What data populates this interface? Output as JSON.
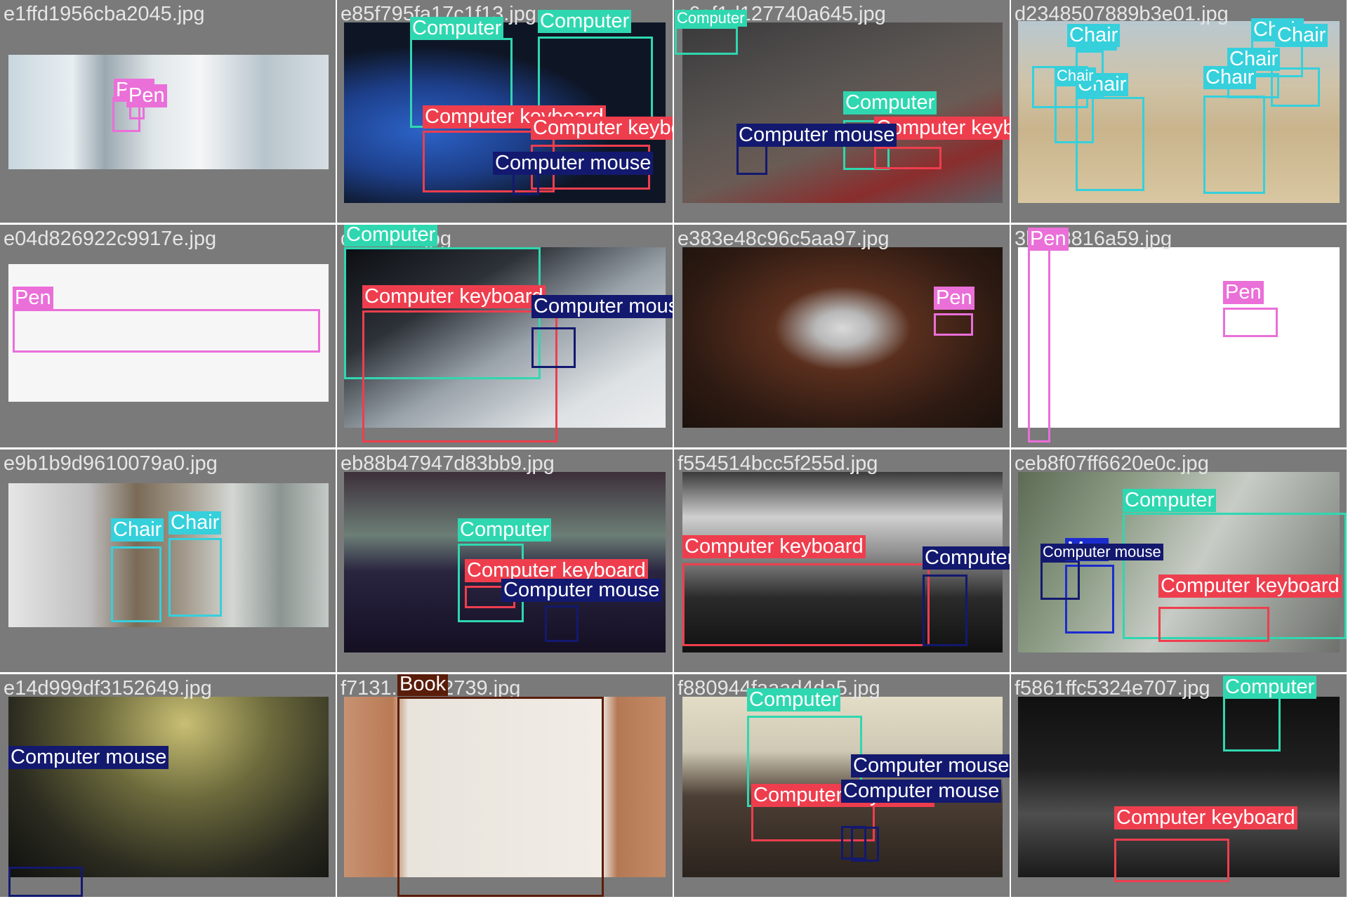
{
  "class_colors": {
    "Pen": "#ea6fd8",
    "Computer": "#2fd7b0",
    "Computer keyboard": "#ee3e4e",
    "Computer mouse": "#13196e",
    "Chair": "#35d0dc",
    "Mug": "#1b2ccf",
    "Book": "#5a1d0a"
  },
  "cells": [
    {
      "filename": "e1ffd1956cba2045.jpg",
      "scene": "wedding-photo-collage",
      "detections": [
        {
          "class": "Pen",
          "label": "Pen"
        },
        {
          "class": "Pen",
          "label": "Pen"
        }
      ]
    },
    {
      "filename": "e85f795fa17c1f13.jpg",
      "scene": "classroom-computer-monitors",
      "detections": [
        {
          "class": "Computer",
          "label": "Computer"
        },
        {
          "class": "Computer",
          "label": "Computer"
        },
        {
          "class": "Computer keyboard",
          "label": "Computer keyboard"
        },
        {
          "class": "Computer keyboard",
          "label": "Computer keyboard"
        },
        {
          "class": "Computer mouse",
          "label": "Computer mouse"
        }
      ]
    },
    {
      "filename": "e6af1d127740a645.jpg",
      "scene": "children-using-laptops",
      "detections": [
        {
          "class": "Computer",
          "label": "Computer"
        },
        {
          "class": "Computer",
          "label": "Computer"
        },
        {
          "class": "Computer keyboard",
          "label": "Computer keyboard"
        },
        {
          "class": "Computer mouse",
          "label": "Computer mouse"
        }
      ]
    },
    {
      "filename": "d2348507889b3e01.jpg",
      "scene": "outdoor-table-and-chairs",
      "detections": [
        {
          "class": "Chair",
          "label": "Chair"
        },
        {
          "class": "Chair",
          "label": "Chair"
        },
        {
          "class": "Chair",
          "label": "Chair"
        },
        {
          "class": "Chair",
          "label": "Chair"
        },
        {
          "class": "Chair",
          "label": "Chair"
        },
        {
          "class": "Chair",
          "label": "Chair"
        },
        {
          "class": "Chair",
          "label": "Chair"
        },
        {
          "class": "Chair",
          "label": "Chair"
        }
      ]
    },
    {
      "filename": "e04d826922c9917e.jpg",
      "scene": "vape-pen-product",
      "detections": [
        {
          "class": "Pen",
          "label": "Pen"
        }
      ]
    },
    {
      "filename": "d7c633d.jpg",
      "scene": "apple-keyboard-and-mouse",
      "detections": [
        {
          "class": "Computer",
          "label": "Computer"
        },
        {
          "class": "Computer keyboard",
          "label": "Computer keyboard"
        },
        {
          "class": "Computer mouse",
          "label": "Computer mouse"
        }
      ]
    },
    {
      "filename": "e383e48c96c5aa97.jpg",
      "scene": "cake-on-plate",
      "detections": [
        {
          "class": "Pen",
          "label": "Pen"
        }
      ]
    },
    {
      "filename": "3b738816a59.jpg",
      "scene": "tablet-with-stylus",
      "detections": [
        {
          "class": "Pen",
          "label": "Pen"
        },
        {
          "class": "Pen",
          "label": "Pen"
        }
      ]
    },
    {
      "filename": "e9b1b9d9610079a0.jpg",
      "scene": "library-room-armchairs",
      "detections": [
        {
          "class": "Chair",
          "label": "Chair"
        },
        {
          "class": "Chair",
          "label": "Chair"
        }
      ]
    },
    {
      "filename": "eb88b47947d83bb9.jpg",
      "scene": "desk-with-cat-and-window",
      "detections": [
        {
          "class": "Computer",
          "label": "Computer"
        },
        {
          "class": "Computer keyboard",
          "label": "Computer keyboard"
        },
        {
          "class": "Computer mouse",
          "label": "Computer mouse"
        }
      ]
    },
    {
      "filename": "f554514bcc5f255d.jpg",
      "scene": "dark-keyboard-closeup",
      "detections": [
        {
          "class": "Computer keyboard",
          "label": "Computer keyboard"
        },
        {
          "class": "Computer mouse",
          "label": "Computer mouse"
        }
      ]
    },
    {
      "filename": "ceb8f07ff6620e0c.jpg",
      "scene": "laptop-outdoors",
      "detections": [
        {
          "class": "Computer",
          "label": "Computer"
        },
        {
          "class": "Computer keyboard",
          "label": "Computer keyboard"
        },
        {
          "class": "Mug",
          "label": "Mug"
        },
        {
          "class": "Computer mouse",
          "label": "Computer mouse"
        }
      ]
    },
    {
      "filename": "e14d999df3152649.jpg",
      "scene": "phone-and-mouse-blur",
      "detections": [
        {
          "class": "Computer mouse",
          "label": "Computer mouse"
        }
      ]
    },
    {
      "filename": "f7131...4252739.jpg",
      "scene": "open-magazine",
      "detections": [
        {
          "class": "Book",
          "label": "Book"
        }
      ]
    },
    {
      "filename": "f880944faaad4da5.jpg",
      "scene": "desk-monitor-waterfall",
      "detections": [
        {
          "class": "Computer",
          "label": "Computer"
        },
        {
          "class": "Computer keyboard",
          "label": "Computer keyboard"
        },
        {
          "class": "Computer mouse",
          "label": "Computer mouse"
        },
        {
          "class": "Computer mouse",
          "label": "Computer mouse"
        }
      ]
    },
    {
      "filename": "f5861ffc5324e707.jpg",
      "scene": "dark-room-laptop-headphones",
      "detections": [
        {
          "class": "Computer",
          "label": "Computer"
        },
        {
          "class": "Computer keyboard",
          "label": "Computer keyboard"
        }
      ]
    }
  ]
}
